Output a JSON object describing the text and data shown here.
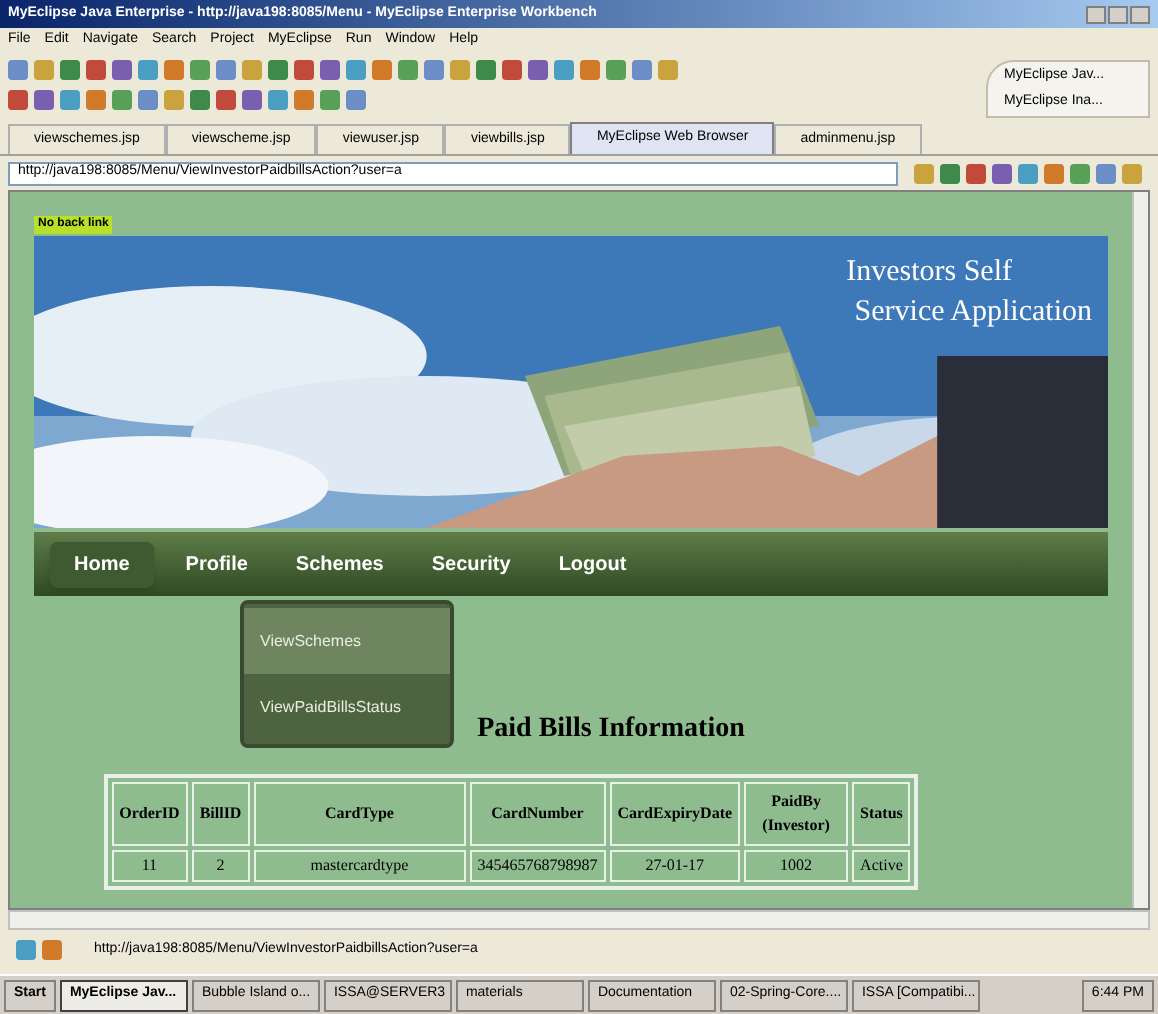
{
  "window": {
    "title": "MyEclipse Java Enterprise - http://java198:8085/Menu - MyEclipse Enterprise Workbench"
  },
  "menu": [
    "File",
    "Edit",
    "Navigate",
    "Search",
    "Project",
    "MyEclipse",
    "Run",
    "Window",
    "Help"
  ],
  "perspectives": [
    "MyEclipse Jav...",
    "MyEclipse Ina..."
  ],
  "editor_tabs": [
    {
      "label": "viewschemes.jsp",
      "selected": false
    },
    {
      "label": "viewscheme.jsp",
      "selected": false
    },
    {
      "label": "viewuser.jsp",
      "selected": false
    },
    {
      "label": "viewbills.jsp",
      "selected": false
    },
    {
      "label": "MyEclipse Web Browser",
      "selected": true
    },
    {
      "label": "adminmenu.jsp",
      "selected": false
    }
  ],
  "address": {
    "value": "http://java198:8085/Menu/ViewInvestorPaidbillsAction?user=a"
  },
  "page": {
    "back_link": "No back link",
    "banner": {
      "title_lines": [
        "Investors Self",
        "Service Application"
      ]
    },
    "nav": [
      {
        "label": "Home",
        "selected": true
      },
      {
        "label": "Profile",
        "selected": false
      },
      {
        "label": "Schemes",
        "selected": false
      },
      {
        "label": "Security",
        "selected": false
      },
      {
        "label": "Logout",
        "selected": false
      }
    ],
    "dropdown": [
      {
        "label": "ViewSchemes",
        "selected": true
      },
      {
        "label": "ViewPaidBillsStatus",
        "selected": false
      }
    ],
    "heading": "Paid Bills Information",
    "table": {
      "columns": [
        "OrderID",
        "BillID",
        "CardType",
        "CardNumber",
        "CardExpiryDate",
        "PaidBy (Investor)",
        "Status"
      ],
      "rows": [
        [
          "11",
          "2",
          "mastercardtype",
          "345465768798987",
          "27-01-17",
          "1002",
          "Active"
        ]
      ]
    }
  },
  "status_bar": {
    "url": "http://java198:8085/Menu/ViewInvestorPaidbillsAction?user=a"
  },
  "taskbar": {
    "start": "Start",
    "items": [
      {
        "label": "MyEclipse Jav...",
        "selected": true
      },
      {
        "label": "Bubble Island o...",
        "selected": false
      },
      {
        "label": "ISSA@SERVER3",
        "selected": false
      },
      {
        "label": "materials",
        "selected": false
      },
      {
        "label": "Documentation",
        "selected": false
      },
      {
        "label": "02-Spring-Core....",
        "selected": false
      },
      {
        "label": "ISSA [Compatibi...",
        "selected": false
      }
    ],
    "clock": "6:44 PM"
  }
}
